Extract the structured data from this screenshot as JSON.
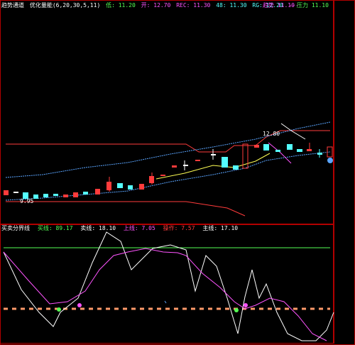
{
  "colors": {
    "background": "#000000",
    "border": "#b20000",
    "up": "#ff3b3b",
    "down": "#54ffff",
    "white": "#ffffff",
    "yellow": "#ffff54",
    "magenta": "#ff54ff",
    "green": "#54ff54",
    "blue": "#5aa5ff"
  },
  "main_panel": {
    "title": "趋势通道",
    "params": "优化量能(6,20,30,5,11)",
    "legend": [
      {
        "label": "低: 11.20",
        "color": "#54ff54"
      },
      {
        "label": "开: 12.70",
        "color": "#ff54ff"
      },
      {
        "label": "REC: 11.30",
        "color": "#ff54ff"
      },
      {
        "label": "48: 11.30",
        "color": "#54ffff"
      },
      {
        "label": "RG: 12.20",
        "color": "#54ffff"
      },
      {
        "label": "---",
        "color": "#ff54ff"
      }
    ],
    "legend_right": [
      {
        "label": "趋势 11.10",
        "color": "#ff54ff"
      },
      {
        "label": "压力 11.10",
        "color": "#54ff54"
      }
    ],
    "marker_high": "12.80",
    "marker_low": "9.95"
  },
  "sub_panel": {
    "title": "买卖分界线",
    "legend": [
      {
        "label": "买线: 89.17",
        "color": "#54ff54"
      },
      {
        "label": "卖线: 18.10",
        "color": "#ffffff"
      },
      {
        "label": "上线: 7.05",
        "color": "#ff54ff"
      },
      {
        "label": "操作: 7.57",
        "color": "#ff3b3b"
      },
      {
        "label": "主线: 17.10",
        "color": "#ffffff"
      }
    ]
  }
}
